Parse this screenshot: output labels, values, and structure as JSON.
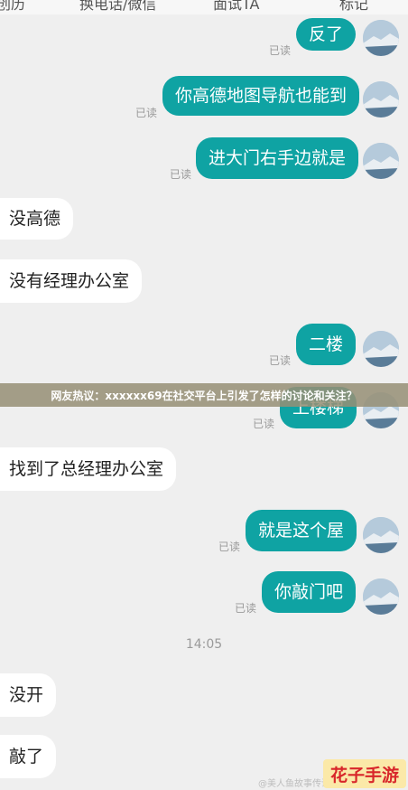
{
  "top_tabs": [
    {
      "label": "创历"
    },
    {
      "label": "换电话/微信"
    },
    {
      "label": "面试TA"
    },
    {
      "label": "标记"
    }
  ],
  "read_label": "已读",
  "messages": [
    {
      "text": "反了"
    },
    {
      "text": "你高德地图导航也能到"
    },
    {
      "text": "进大门右手边就是"
    },
    {
      "text": "没高德"
    },
    {
      "text": "没有经理办公室"
    },
    {
      "text": "二楼"
    },
    {
      "text": "上楼梯"
    },
    {
      "text": "找到了总经理办公室"
    },
    {
      "text": "就是这个屋"
    },
    {
      "text": "你敲门吧"
    },
    {
      "text": "没开"
    },
    {
      "text": "敲了"
    }
  ],
  "timestamp": "14:05",
  "banner": "网友热议：xxxxxx69在社交平台上引发了怎样的讨论和关注？",
  "watermark": "@美人鱼故事传说",
  "logo": "花子手游"
}
